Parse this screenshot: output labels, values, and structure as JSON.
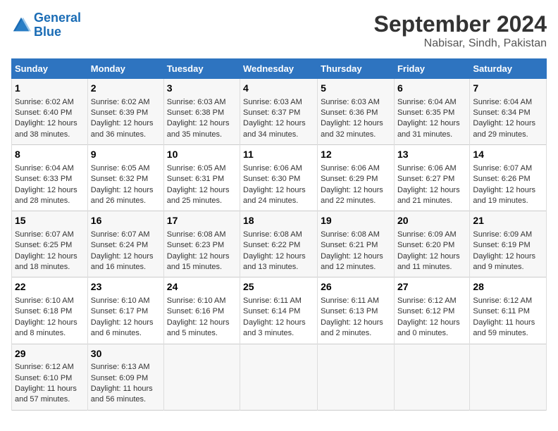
{
  "logo": {
    "text_general": "General",
    "text_blue": "Blue"
  },
  "title": "September 2024",
  "subtitle": "Nabisar, Sindh, Pakistan",
  "headers": [
    "Sunday",
    "Monday",
    "Tuesday",
    "Wednesday",
    "Thursday",
    "Friday",
    "Saturday"
  ],
  "weeks": [
    [
      {
        "day": "1",
        "content": "Sunrise: 6:02 AM\nSunset: 6:40 PM\nDaylight: 12 hours\nand 38 minutes."
      },
      {
        "day": "2",
        "content": "Sunrise: 6:02 AM\nSunset: 6:39 PM\nDaylight: 12 hours\nand 36 minutes."
      },
      {
        "day": "3",
        "content": "Sunrise: 6:03 AM\nSunset: 6:38 PM\nDaylight: 12 hours\nand 35 minutes."
      },
      {
        "day": "4",
        "content": "Sunrise: 6:03 AM\nSunset: 6:37 PM\nDaylight: 12 hours\nand 34 minutes."
      },
      {
        "day": "5",
        "content": "Sunrise: 6:03 AM\nSunset: 6:36 PM\nDaylight: 12 hours\nand 32 minutes."
      },
      {
        "day": "6",
        "content": "Sunrise: 6:04 AM\nSunset: 6:35 PM\nDaylight: 12 hours\nand 31 minutes."
      },
      {
        "day": "7",
        "content": "Sunrise: 6:04 AM\nSunset: 6:34 PM\nDaylight: 12 hours\nand 29 minutes."
      }
    ],
    [
      {
        "day": "8",
        "content": "Sunrise: 6:04 AM\nSunset: 6:33 PM\nDaylight: 12 hours\nand 28 minutes."
      },
      {
        "day": "9",
        "content": "Sunrise: 6:05 AM\nSunset: 6:32 PM\nDaylight: 12 hours\nand 26 minutes."
      },
      {
        "day": "10",
        "content": "Sunrise: 6:05 AM\nSunset: 6:31 PM\nDaylight: 12 hours\nand 25 minutes."
      },
      {
        "day": "11",
        "content": "Sunrise: 6:06 AM\nSunset: 6:30 PM\nDaylight: 12 hours\nand 24 minutes."
      },
      {
        "day": "12",
        "content": "Sunrise: 6:06 AM\nSunset: 6:29 PM\nDaylight: 12 hours\nand 22 minutes."
      },
      {
        "day": "13",
        "content": "Sunrise: 6:06 AM\nSunset: 6:27 PM\nDaylight: 12 hours\nand 21 minutes."
      },
      {
        "day": "14",
        "content": "Sunrise: 6:07 AM\nSunset: 6:26 PM\nDaylight: 12 hours\nand 19 minutes."
      }
    ],
    [
      {
        "day": "15",
        "content": "Sunrise: 6:07 AM\nSunset: 6:25 PM\nDaylight: 12 hours\nand 18 minutes."
      },
      {
        "day": "16",
        "content": "Sunrise: 6:07 AM\nSunset: 6:24 PM\nDaylight: 12 hours\nand 16 minutes."
      },
      {
        "day": "17",
        "content": "Sunrise: 6:08 AM\nSunset: 6:23 PM\nDaylight: 12 hours\nand 15 minutes."
      },
      {
        "day": "18",
        "content": "Sunrise: 6:08 AM\nSunset: 6:22 PM\nDaylight: 12 hours\nand 13 minutes."
      },
      {
        "day": "19",
        "content": "Sunrise: 6:08 AM\nSunset: 6:21 PM\nDaylight: 12 hours\nand 12 minutes."
      },
      {
        "day": "20",
        "content": "Sunrise: 6:09 AM\nSunset: 6:20 PM\nDaylight: 12 hours\nand 11 minutes."
      },
      {
        "day": "21",
        "content": "Sunrise: 6:09 AM\nSunset: 6:19 PM\nDaylight: 12 hours\nand 9 minutes."
      }
    ],
    [
      {
        "day": "22",
        "content": "Sunrise: 6:10 AM\nSunset: 6:18 PM\nDaylight: 12 hours\nand 8 minutes."
      },
      {
        "day": "23",
        "content": "Sunrise: 6:10 AM\nSunset: 6:17 PM\nDaylight: 12 hours\nand 6 minutes."
      },
      {
        "day": "24",
        "content": "Sunrise: 6:10 AM\nSunset: 6:16 PM\nDaylight: 12 hours\nand 5 minutes."
      },
      {
        "day": "25",
        "content": "Sunrise: 6:11 AM\nSunset: 6:14 PM\nDaylight: 12 hours\nand 3 minutes."
      },
      {
        "day": "26",
        "content": "Sunrise: 6:11 AM\nSunset: 6:13 PM\nDaylight: 12 hours\nand 2 minutes."
      },
      {
        "day": "27",
        "content": "Sunrise: 6:12 AM\nSunset: 6:12 PM\nDaylight: 12 hours\nand 0 minutes."
      },
      {
        "day": "28",
        "content": "Sunrise: 6:12 AM\nSunset: 6:11 PM\nDaylight: 11 hours\nand 59 minutes."
      }
    ],
    [
      {
        "day": "29",
        "content": "Sunrise: 6:12 AM\nSunset: 6:10 PM\nDaylight: 11 hours\nand 57 minutes."
      },
      {
        "day": "30",
        "content": "Sunrise: 6:13 AM\nSunset: 6:09 PM\nDaylight: 11 hours\nand 56 minutes."
      },
      {
        "day": "",
        "content": ""
      },
      {
        "day": "",
        "content": ""
      },
      {
        "day": "",
        "content": ""
      },
      {
        "day": "",
        "content": ""
      },
      {
        "day": "",
        "content": ""
      }
    ]
  ]
}
